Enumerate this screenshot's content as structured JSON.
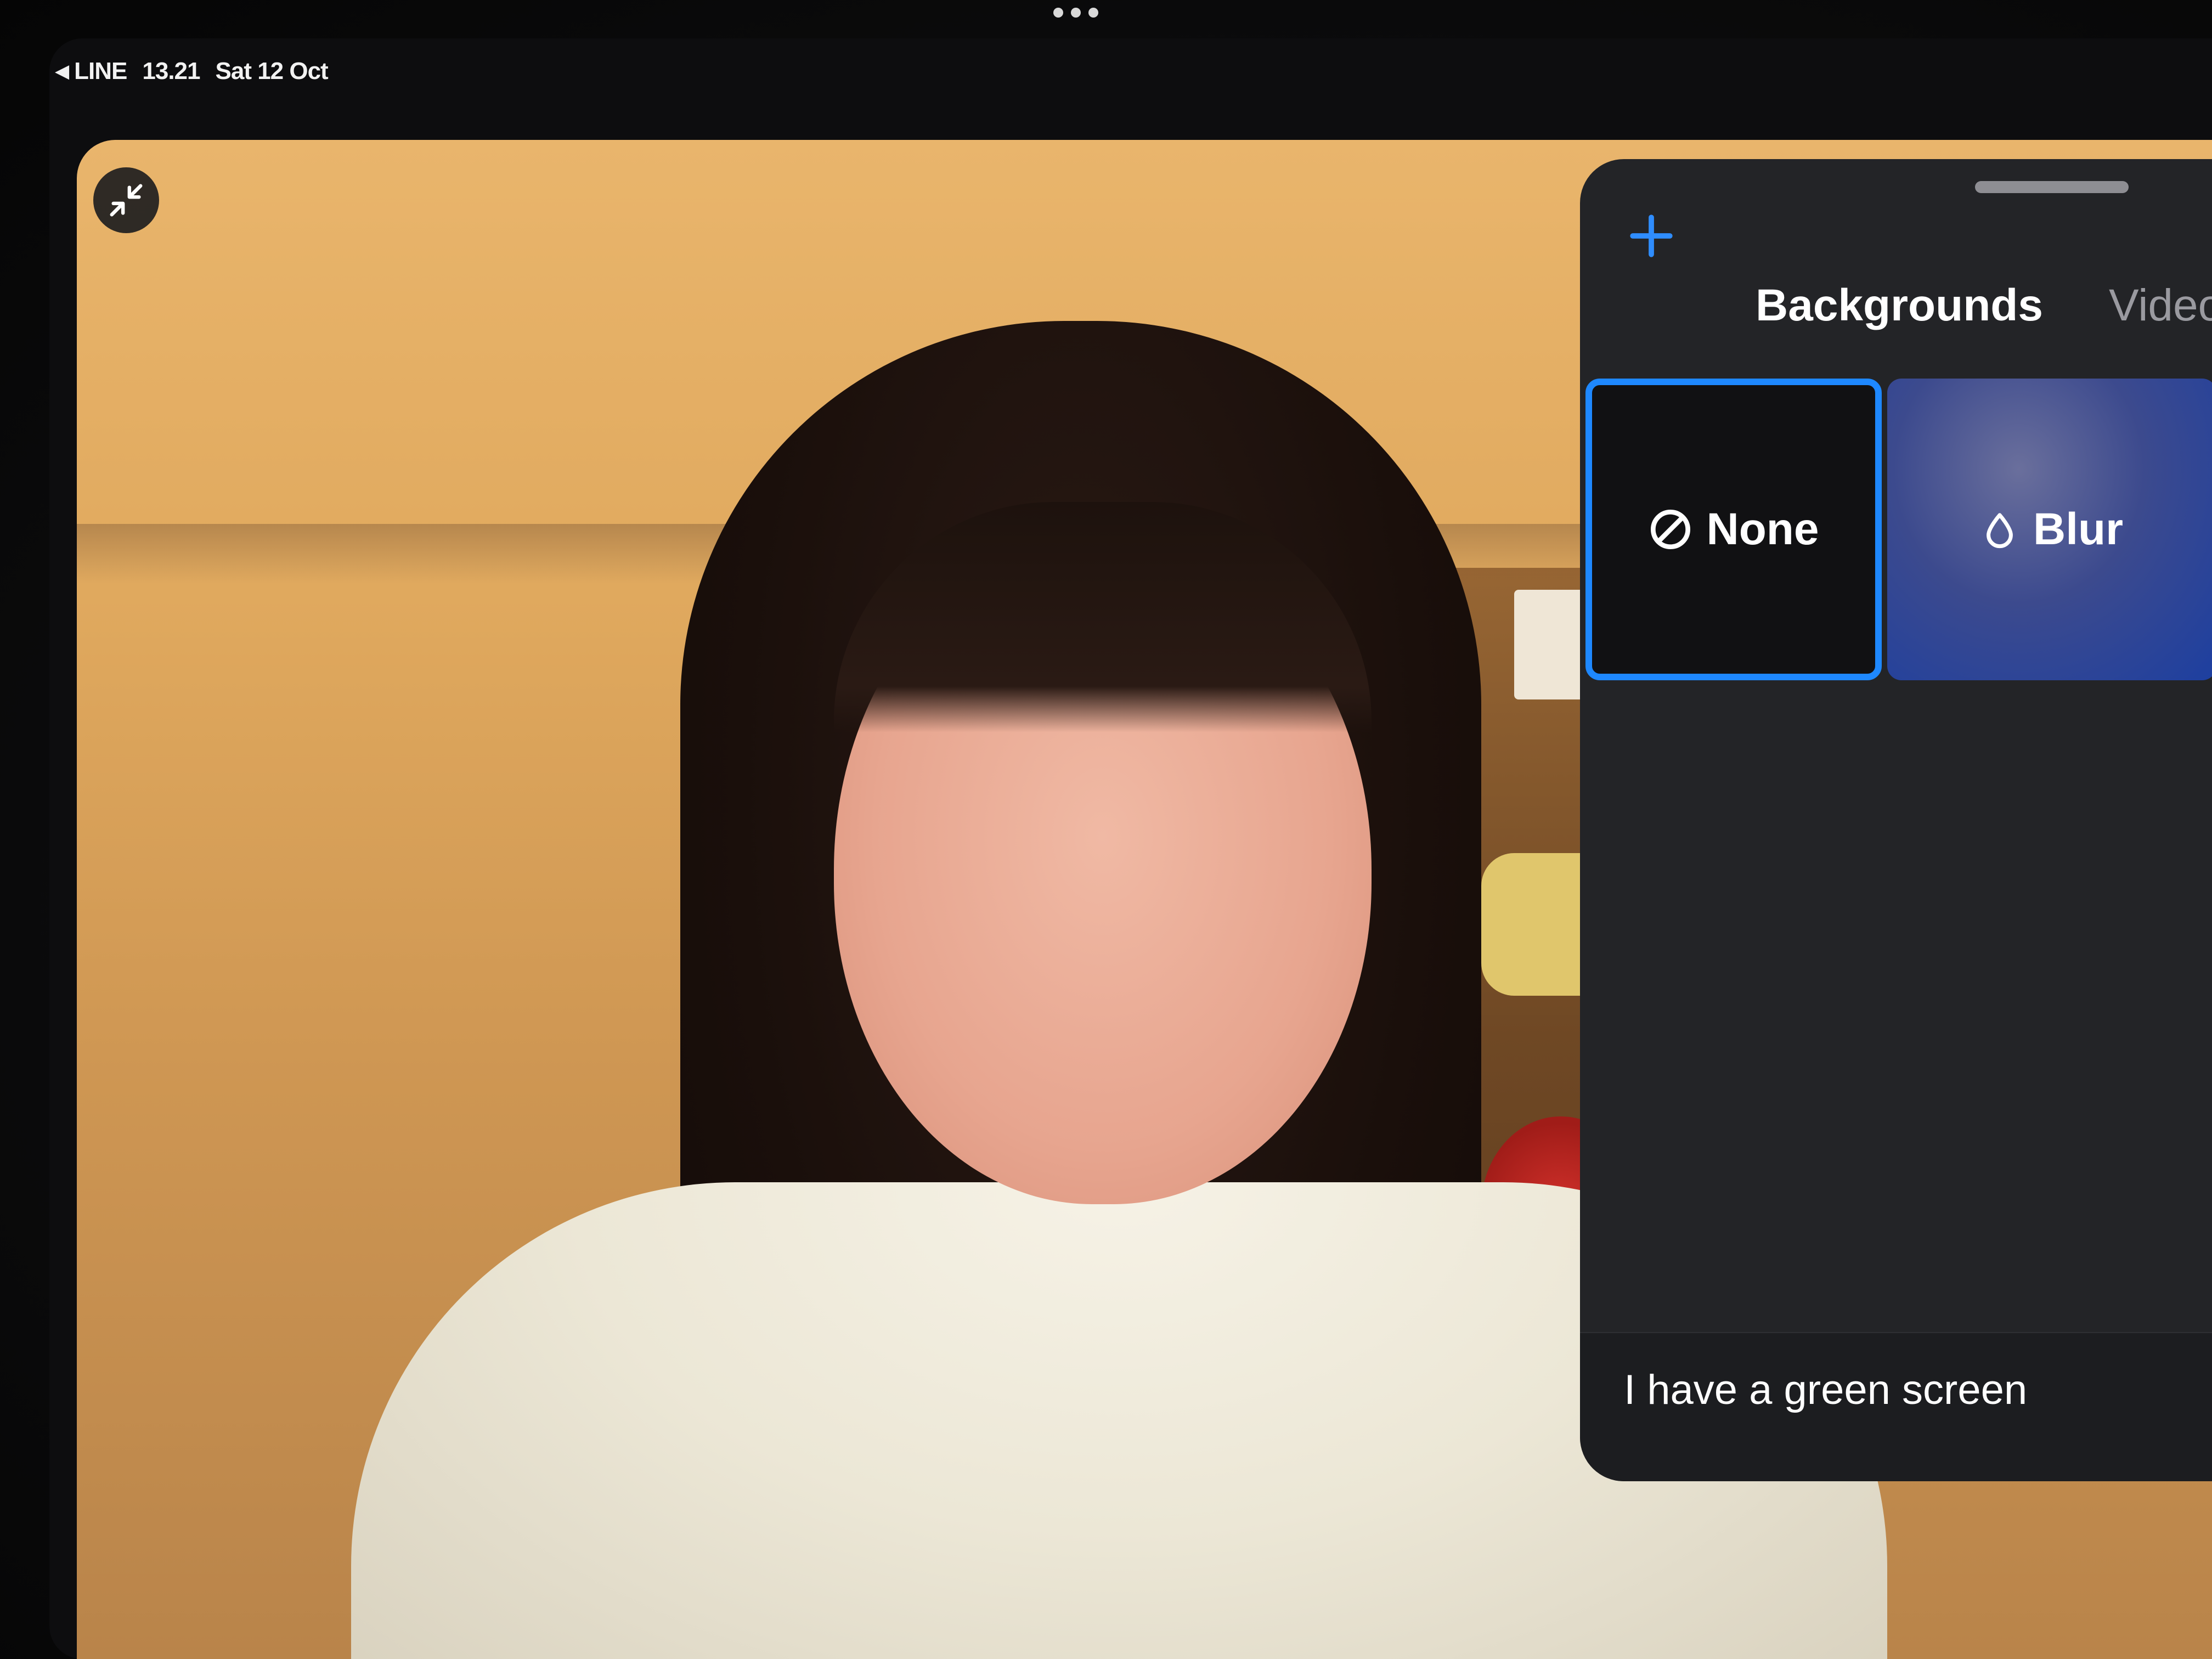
{
  "status_bar": {
    "back_app": "LINE",
    "time": "13.21",
    "date": "Sat 12 Oct"
  },
  "camera": {
    "collapse_icon": "collapse-arrows-icon"
  },
  "panel": {
    "add_icon": "plus-icon",
    "tabs": [
      {
        "label": "Backgrounds",
        "active": true
      },
      {
        "label": "Video",
        "active": false
      }
    ],
    "options": [
      {
        "label": "None",
        "icon": "no-symbol-icon",
        "selected": true
      },
      {
        "label": "Blur",
        "icon": "droplet-icon",
        "selected": false
      }
    ],
    "footer_label": "I have a green screen"
  },
  "colors": {
    "accent": "#1e88ff",
    "panel_bg": "#232427"
  }
}
